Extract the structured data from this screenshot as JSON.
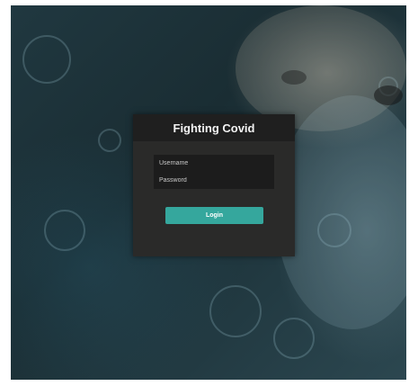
{
  "login": {
    "title": "Fighting Covid",
    "username_placeholder": "Username",
    "password_placeholder": "Password",
    "button_label": "Login"
  },
  "colors": {
    "accent": "#35a79d",
    "card_background": "#2a2a29",
    "header_background": "#1f1f1f"
  }
}
